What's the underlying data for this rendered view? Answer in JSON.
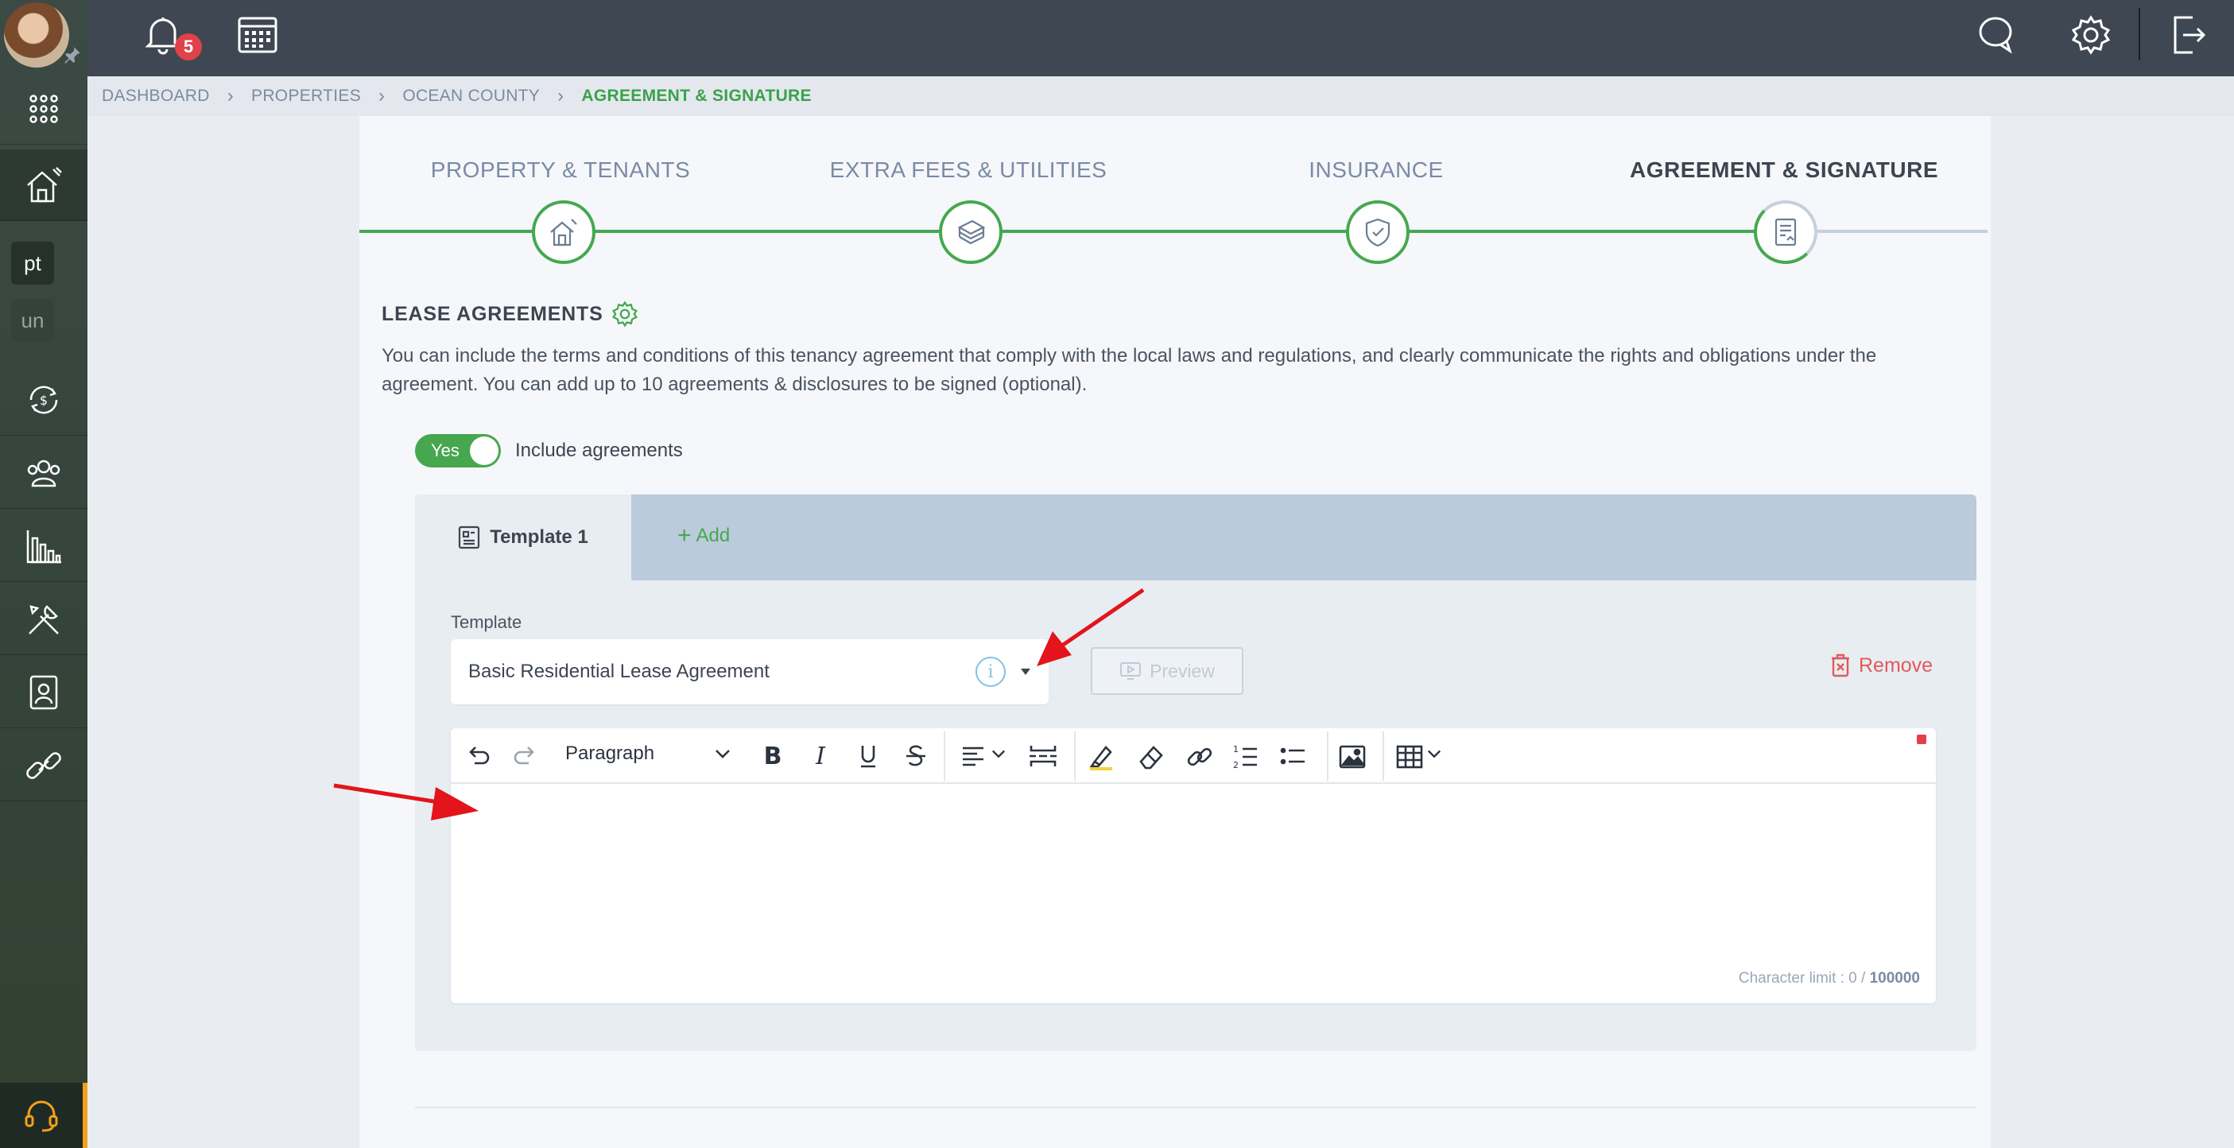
{
  "topbar": {
    "notification_count": "5"
  },
  "sidebar": {
    "pills": [
      "pt",
      "un"
    ]
  },
  "breadcrumb": [
    "DASHBOARD",
    "PROPERTIES",
    "OCEAN COUNTY",
    "AGREEMENT & SIGNATURE"
  ],
  "steps": [
    {
      "label": "PROPERTY & TENANTS",
      "icon": "house-icon"
    },
    {
      "label": "EXTRA FEES & UTILITIES",
      "icon": "money-stack-icon"
    },
    {
      "label": "INSURANCE",
      "icon": "shield-icon"
    },
    {
      "label": "AGREEMENT & SIGNATURE",
      "icon": "document-icon"
    }
  ],
  "section": {
    "title": "LEASE AGREEMENTS",
    "description": "You can include the terms and conditions of this tenancy agreement that comply with the local laws and regulations, and clearly communicate the rights and obligations under the agreement. You can add up to 10 agreements & disclosures to be signed (optional).",
    "toggle_value": "Yes",
    "toggle_label": "Include agreements"
  },
  "template": {
    "tab_label": "Template 1",
    "add_label": "Add",
    "field_label": "Template",
    "selected": "Basic Residential Lease Agreement",
    "preview_label": "Preview",
    "remove_label": "Remove"
  },
  "editor": {
    "block_format": "Paragraph",
    "char_limit_label": "Character limit : 0 / ",
    "char_limit_max": "100000"
  },
  "colors": {
    "accent_green": "#45a84f",
    "danger_red": "#e25a5a",
    "topbar": "#3e4752"
  }
}
